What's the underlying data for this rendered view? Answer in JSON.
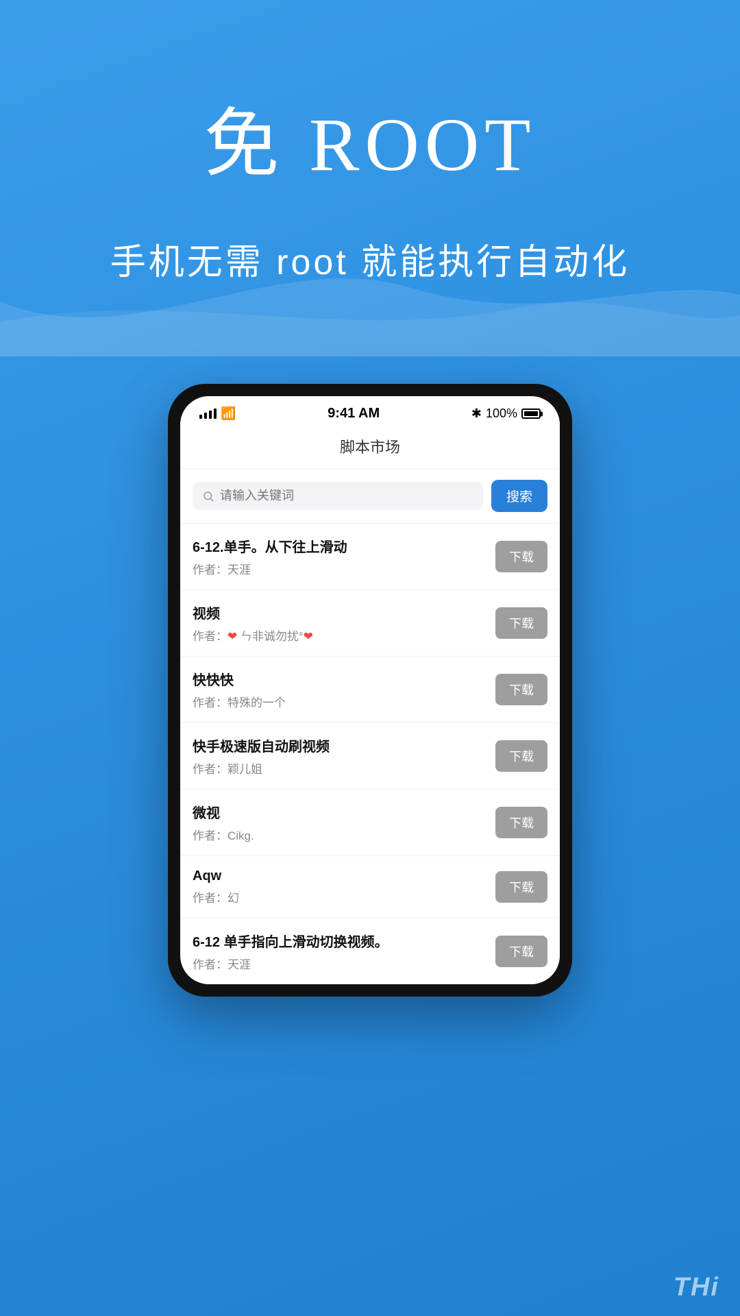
{
  "hero": {
    "title": "免 ROOT",
    "subtitle": "手机无需 root 就能执行自动化"
  },
  "phone": {
    "status_bar": {
      "time": "9:41 AM",
      "battery_pct": "100%",
      "bluetooth": "✱"
    },
    "header": {
      "title": "脚本市场"
    },
    "search": {
      "placeholder": "请输入关键词",
      "button_label": "搜索"
    },
    "scripts": [
      {
        "name": "6-12.单手。从下往上滑动",
        "author": "作者：天涯",
        "download_label": "下载"
      },
      {
        "name": "视频",
        "author_parts": [
          "作者：",
          "❤",
          " ㄣ非诚勿扰°",
          "❤"
        ],
        "author": "作者：❤ ㄣ非诚勿扰°❤",
        "download_label": "下载"
      },
      {
        "name": "快快快",
        "author": "作者：特殊的一个",
        "download_label": "下载"
      },
      {
        "name": "快手极速版自动刷视频",
        "author": "作者：颖儿姐",
        "download_label": "下载"
      },
      {
        "name": "微视",
        "author": "作者：Cikg.",
        "download_label": "下载"
      },
      {
        "name": "Aqw",
        "author": "作者：幻",
        "download_label": "下载"
      },
      {
        "name": "6-12 单手指向上滑动切换视频。",
        "author": "作者：天涯",
        "download_label": "下载"
      }
    ]
  },
  "watermark": {
    "text": "THi"
  }
}
